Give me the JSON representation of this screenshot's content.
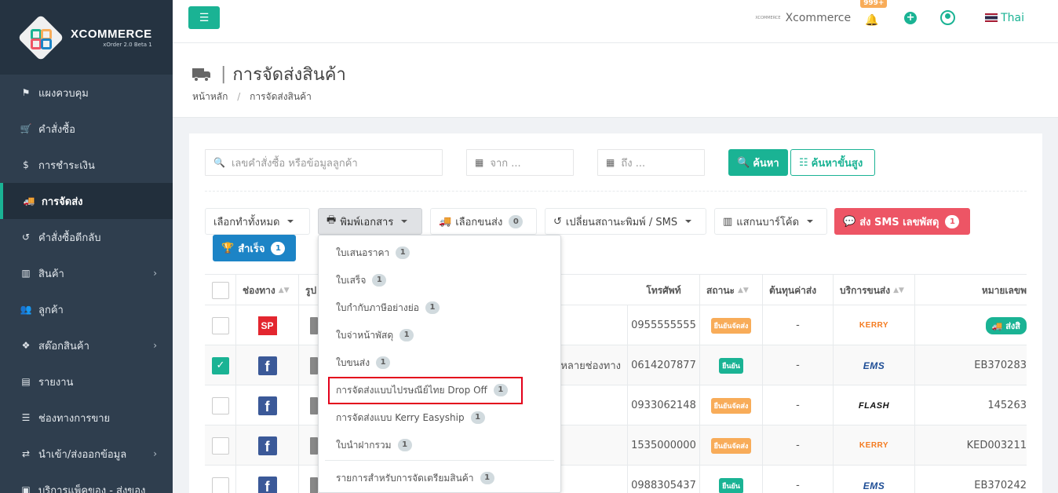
{
  "brand": {
    "name": "XCOMMERCE",
    "sub": "xOrder 2.0 Beta 1"
  },
  "sidebar": {
    "items": [
      {
        "label": "แผงควบคุม",
        "icon": "flag-icon",
        "glyph": "⚑"
      },
      {
        "label": "คำสั่งซื้อ",
        "icon": "cart-icon",
        "glyph": "🛒"
      },
      {
        "label": "การชำระเงิน",
        "icon": "dollar-icon",
        "glyph": "$"
      },
      {
        "label": "การจัดส่ง",
        "icon": "truck-icon",
        "glyph": "🚚",
        "active": true
      },
      {
        "label": "คำสั่งซื้อตีกลับ",
        "icon": "undo-icon",
        "glyph": "↺"
      },
      {
        "label": "สินค้า",
        "icon": "barcode-icon",
        "glyph": "▥",
        "chevron": true
      },
      {
        "label": "ลูกค้า",
        "icon": "users-icon",
        "glyph": "👥"
      },
      {
        "label": "สต๊อกสินค้า",
        "icon": "cubes-icon",
        "glyph": "❖",
        "chevron": true
      },
      {
        "label": "รายงาน",
        "icon": "bar-chart-icon",
        "glyph": "▤"
      },
      {
        "label": "ช่องทางการขาย",
        "icon": "server-icon",
        "glyph": "☰"
      },
      {
        "label": "นำเข้า/ส่งออกข้อมูล",
        "icon": "exchange-icon",
        "glyph": "⇄",
        "chevron": true
      },
      {
        "label": "บริการแพ็คของ - ส่งของ",
        "icon": "box-icon",
        "glyph": "▣"
      }
    ]
  },
  "topbar": {
    "mini_logo": "XCOMMERCE",
    "brand": "Xcommerce",
    "notif_badge": "999+",
    "lang": "Thai"
  },
  "page": {
    "title": "การจัดส่งสินค้า",
    "title_sep": "|",
    "breadcrumb": [
      "หน้าหลัก",
      "การจัดส่งสินค้า"
    ]
  },
  "filters": {
    "search_placeholder": "เลขคำสั่งซื้อ หรือข้อมูลลูกค้า",
    "from_placeholder": "จาก ...",
    "to_placeholder": "ถึง ...",
    "search_btn": "ค้นหา",
    "advanced_btn": "ค้นหาขั้นสูง"
  },
  "actions": {
    "select_all": "เลือกทำทั้งหมด",
    "print_docs": "พิมพ์เอกสาร",
    "select_carrier": "เลือกขนส่ง",
    "select_carrier_count": "0",
    "change_status": "เปลี่ยนสถานะพิมพ์ / SMS",
    "scan_barcode": "แสกนบาร์โค้ด",
    "send_sms": "ส่ง SMS เลขพัสดุ",
    "send_sms_count": "1",
    "success": "สำเร็จ",
    "success_count": "1"
  },
  "table": {
    "headers": [
      "ช่องทาง",
      "รูป",
      "โทรศัพท์",
      "สถานะ",
      "ต้นทุนค่าส่ง",
      "บริการขนส่ง",
      "หมายเลขพ"
    ],
    "rows": [
      {
        "channel": "SP",
        "channel_type": "shopee",
        "phone": "0955555555",
        "status": "ยืนยันจัดส่ง",
        "status_color": "#f8ac59",
        "cost": "-",
        "carrier": "KERRY",
        "carrier_type": "kerry",
        "tracking": "ส่งสิ",
        "checked": false,
        "extra": ""
      },
      {
        "channel": "f",
        "channel_type": "facebook",
        "phone": "0614207877",
        "status": "ยืนยัน",
        "status_color": "#1ab394",
        "cost": "-",
        "carrier": "EMS",
        "carrier_type": "ems",
        "tracking": "EB370283",
        "checked": true,
        "extra": "หลายช่องทาง"
      },
      {
        "channel": "f",
        "channel_type": "facebook",
        "phone": "0933062148",
        "status": "ยืนยันจัดส่ง",
        "status_color": "#f8ac59",
        "cost": "-",
        "carrier": "FLASH",
        "carrier_type": "flash",
        "tracking": "145263",
        "checked": false,
        "extra": ""
      },
      {
        "channel": "f",
        "channel_type": "facebook",
        "phone": "1535000000",
        "status": "ยืนยันจัดส่ง",
        "status_color": "#f8ac59",
        "cost": "-",
        "carrier": "KERRY",
        "carrier_type": "kerry",
        "tracking": "KED003211",
        "checked": false,
        "extra": ""
      },
      {
        "channel": "f",
        "channel_type": "facebook",
        "phone": "0988305437",
        "status": "ยืนยัน",
        "status_color": "#1ab394",
        "cost": "-",
        "carrier": "EMS",
        "carrier_type": "ems",
        "tracking": "EB370242",
        "checked": false,
        "extra": ""
      }
    ]
  },
  "print_menu": {
    "items": [
      {
        "label": "ใบเสนอราคา",
        "count": "1"
      },
      {
        "label": "ใบเสร็จ",
        "count": "1"
      },
      {
        "label": "ใบกำกับภาษีอย่างย่อ",
        "count": "1"
      },
      {
        "label": "ใบจ่าหน้าพัสดุ",
        "count": "1"
      },
      {
        "label": "ใบขนส่ง",
        "count": "1"
      },
      {
        "label": "การจัดส่งแบบไปรษณีย์ไทย Drop Off",
        "count": "1",
        "highlighted": true
      },
      {
        "label": "การจัดส่งแบบ Kerry Easyship",
        "count": "1"
      },
      {
        "label": "ใบนำฝากรวม",
        "count": "1"
      },
      {
        "label": "รายการสำหรับการจัดเตรียมสินค้า",
        "count": "1"
      }
    ]
  },
  "colors": {
    "accent": "#1ab394",
    "sidebar": "#2f3e4e",
    "danger": "#ed5565",
    "primary": "#1c84c6",
    "warning": "#f8ac59",
    "highlight": "#e3001b"
  }
}
